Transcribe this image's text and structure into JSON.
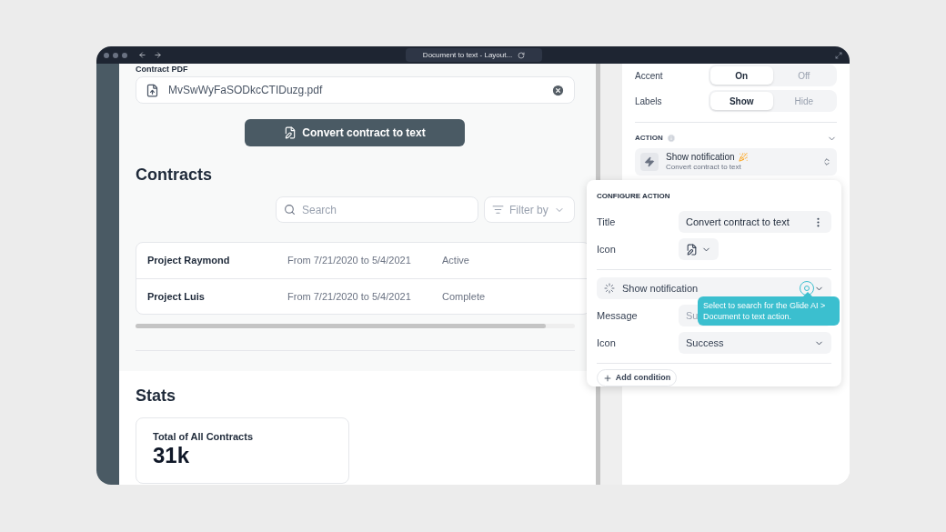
{
  "browser": {
    "tab_title": "Document to text - Layout..."
  },
  "form": {
    "label": "Contract PDF",
    "file_name": "MvSwWyFaSODkcCTIDuzg.pdf",
    "button": "Convert contract to text"
  },
  "contracts": {
    "heading": "Contracts",
    "search": {
      "placeholder": "Search"
    },
    "filter": "Filter by",
    "rows": [
      {
        "name": "Project Raymond",
        "dates": "From 7/21/2020 to 5/4/2021",
        "status": "Active"
      },
      {
        "name": "Project Luis",
        "dates": "From 7/21/2020 to 5/4/2021",
        "status": "Complete"
      }
    ]
  },
  "stats": {
    "heading": "Stats",
    "cards": [
      {
        "label": "Total of All Contracts",
        "value": "31k"
      }
    ]
  },
  "settings": [
    {
      "label": "Accent",
      "options": [
        {
          "label": "On",
          "selected": true
        },
        {
          "label": "Off",
          "selected": false
        }
      ]
    },
    {
      "label": "Labels",
      "options": [
        {
          "label": "Show",
          "selected": true
        },
        {
          "label": "Hide",
          "selected": false
        }
      ]
    }
  ],
  "action": {
    "heading": "ACTION",
    "title": "Show notification",
    "subtitle": "Convert contract to text"
  },
  "configure": {
    "heading": "CONFIGURE ACTION",
    "fields": [
      {
        "kind": "text",
        "label": "Title",
        "value": "Convert contract to text"
      },
      {
        "kind": "icon",
        "label": "Icon"
      },
      {
        "kind": "action",
        "value": "Show notification"
      },
      {
        "kind": "placeholder",
        "label": "Message",
        "placeholder": "Su"
      },
      {
        "kind": "select",
        "label": "Icon",
        "value": "Success"
      }
    ],
    "add_condition": "Add condition"
  },
  "tooltip": "Select to search for the Glide AI > Document to text action."
}
